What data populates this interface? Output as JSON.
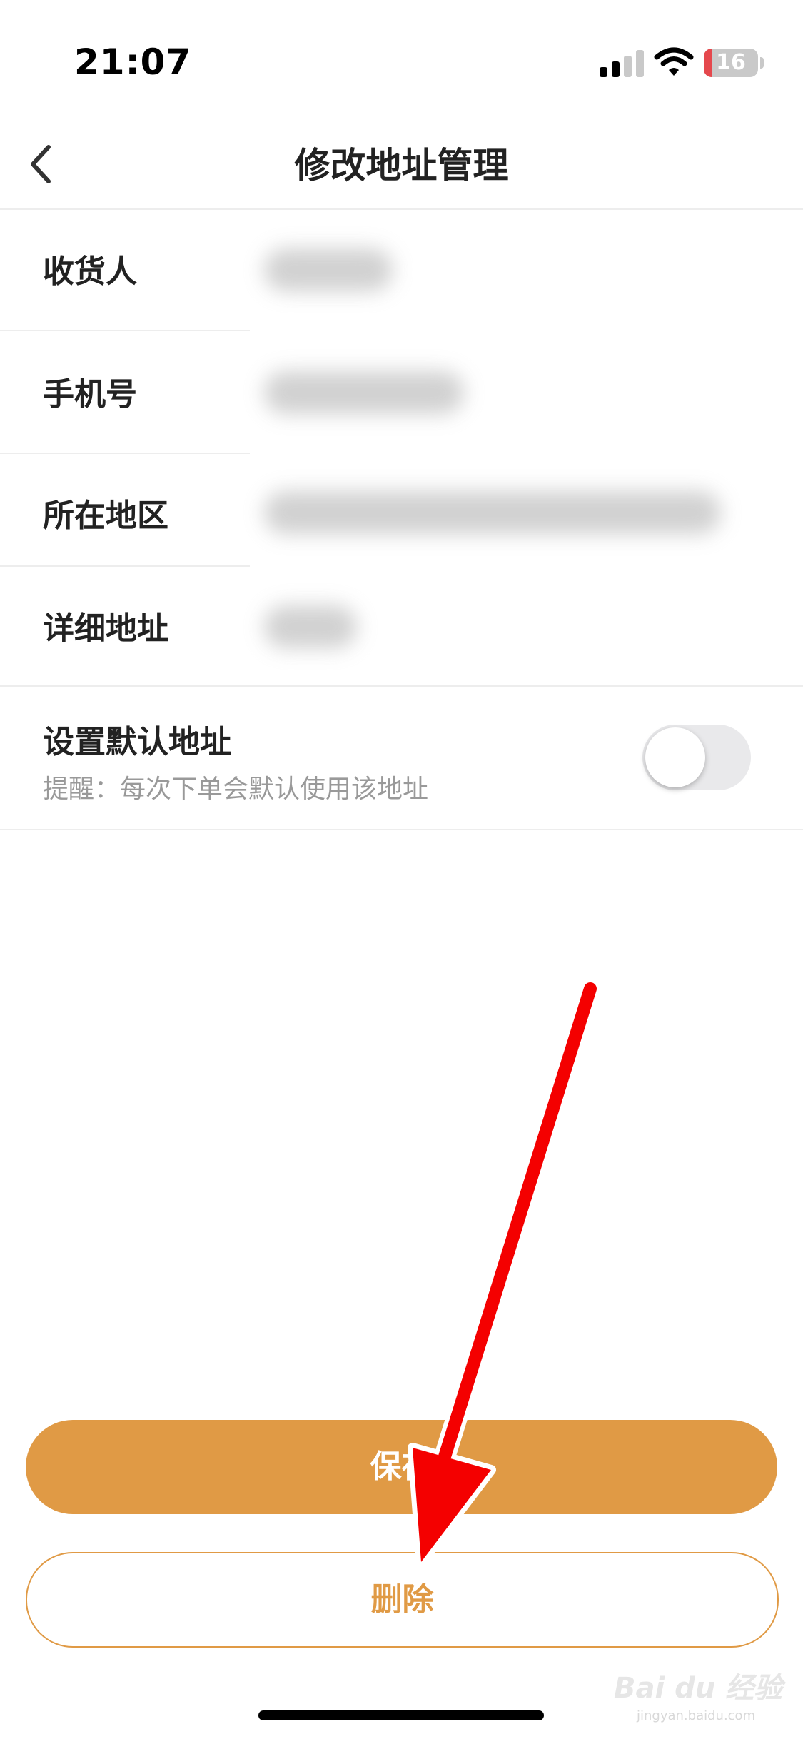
{
  "status_bar": {
    "time": "21:07",
    "battery": "16",
    "battery_level": 0.16,
    "battery_color": "#e5484d"
  },
  "nav": {
    "title": "修改地址管理",
    "back_icon": "chevron-left-icon"
  },
  "form": {
    "receiver_label": "收货人",
    "phone_label": "手机号",
    "region_label": "所在地区",
    "detail_label": "详细地址"
  },
  "default_address": {
    "title": "设置默认地址",
    "hint": "提醒：每次下单会默认使用该地址",
    "enabled": false
  },
  "actions": {
    "save_label": "保存",
    "delete_label": "删除"
  },
  "watermark": {
    "text": "Bai du 经验",
    "sub": "jingyan.baidu.com"
  },
  "colors": {
    "accent": "#e09a45",
    "annotation_arrow": "#f40000"
  }
}
